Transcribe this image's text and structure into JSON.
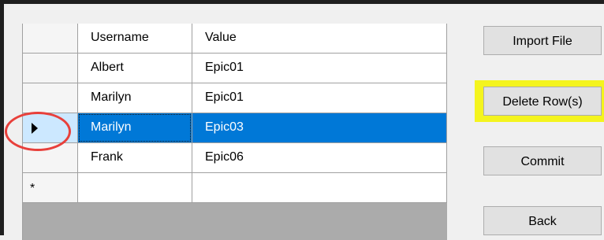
{
  "grid": {
    "columns": {
      "username": "Username",
      "value": "Value"
    },
    "rows": [
      {
        "username": "Albert",
        "value": "Epic01"
      },
      {
        "username": "Marilyn",
        "value": "Epic01"
      },
      {
        "username": "Marilyn",
        "value": "Epic03"
      },
      {
        "username": "Frank",
        "value": "Epic06"
      }
    ],
    "new_row_marker": "*"
  },
  "buttons": {
    "import": "Import File",
    "delete": "Delete Row(s)",
    "commit": "Commit",
    "back": "Back"
  },
  "colors": {
    "selection": "#0078d7",
    "annotation_circle": "#e8403b",
    "annotation_highlight": "#f4f41e"
  }
}
